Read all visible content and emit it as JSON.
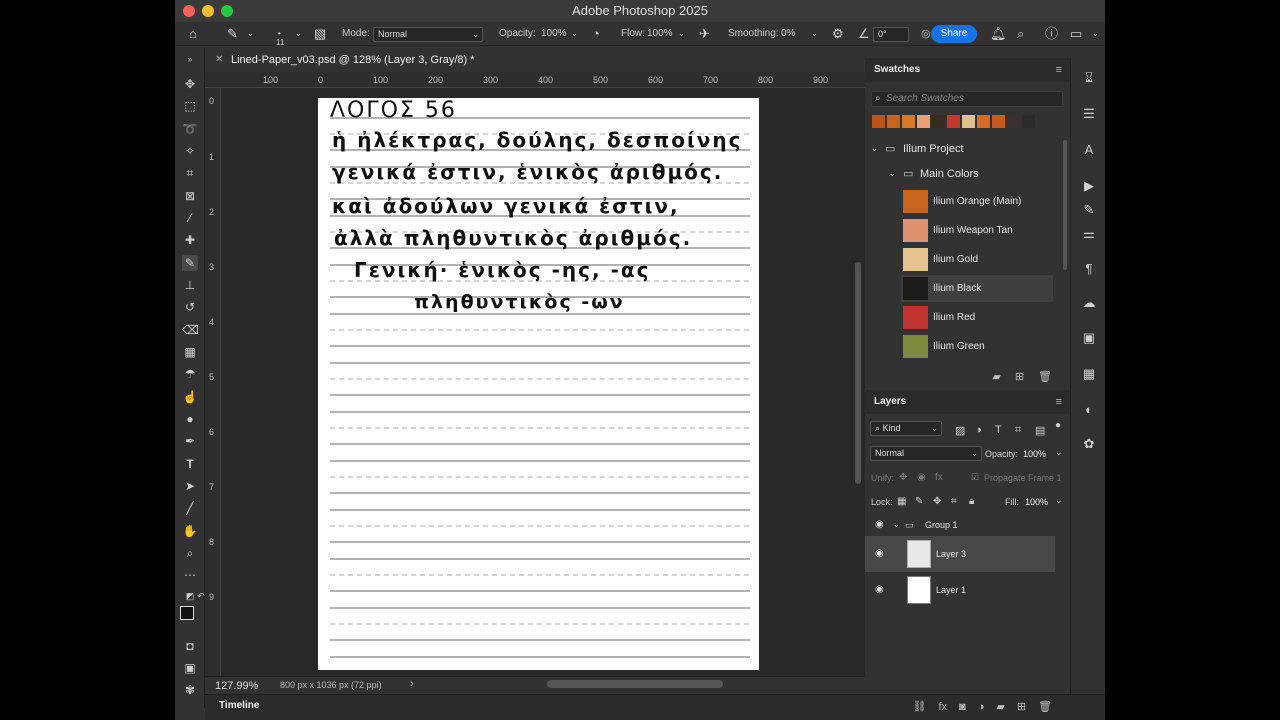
{
  "window": {
    "title": "Adobe Photoshop 2025"
  },
  "options": {
    "brush_size": "11",
    "mode_label": "Mode:",
    "mode_value": "Normal",
    "opacity_label": "Opacity:",
    "opacity_value": "100%",
    "flow_label": "Flow:",
    "flow_value": "100%",
    "smoothing_label": "Smoothing:",
    "smoothing_value": "0%",
    "angle_value": "0°",
    "share_label": "Share"
  },
  "document": {
    "tab_title": "Lined-Paper_v03.psd @ 128% (Layer 3, Gray/8) *",
    "ruler_h": [
      "100",
      "0",
      "100",
      "200",
      "300",
      "400",
      "500",
      "600",
      "700",
      "800",
      "900"
    ],
    "ruler_v": [
      "0",
      "1",
      "2",
      "3",
      "4",
      "5",
      "6",
      "7",
      "8",
      "9"
    ],
    "handwriting": [
      "ΛΟΓΟΣ 56",
      "ἡ ἠλέκτρας, δούλης, δεσποίνης",
      "γενικά ἐστιν, ἑνικὸς ἀριθμός.",
      "καὶ ἀδούλων γενικά ἐστιν,",
      "ἀλλὰ πληθυντικὸς ἀριθμός.",
      "Γενική· ἑνικὸς -ης, -ας",
      "πληθυντικὸς -ων"
    ]
  },
  "status": {
    "zoom": "127.99%",
    "doc_size": "800 px x 1036 px (72 ppi)",
    "arrow": "›"
  },
  "timeline": {
    "label": "Timeline"
  },
  "swatches": {
    "title": "Swatches",
    "search_placeholder": "Search Swatches",
    "strip_colors": [
      "#b8541c",
      "#c8641e",
      "#d87a2c",
      "#e8a070",
      "#3a2a22",
      "#c03a28",
      "#e0c08c",
      "#d86a24",
      "#c85a1c",
      "#3a3030",
      "#2c2c2c"
    ],
    "folder": "Ilium Project",
    "subfolder": "Main Colors",
    "colors": [
      {
        "name": "Ilium Orange (Main)",
        "hex": "#c8641e"
      },
      {
        "name": "Ilium Weapon Tan",
        "hex": "#e0926c"
      },
      {
        "name": "Ilium Gold",
        "hex": "#e4c48c"
      },
      {
        "name": "Ilium Black",
        "hex": "#1e1a18"
      },
      {
        "name": "Ilium Red",
        "hex": "#c03430"
      },
      {
        "name": "Ilium Green",
        "hex": "#7a8c3c"
      }
    ]
  },
  "layers": {
    "title": "Layers",
    "filter_kind": "Kind",
    "blend_mode": "Normal",
    "opacity_label": "Opacity:",
    "opacity_value": "100%",
    "unify_label": "Unify:",
    "propagate_label": "Propagate Frame 1",
    "lock_label": "Lock:",
    "fill_label": "Fill:",
    "fill_value": "100%",
    "items": [
      {
        "name": "Group 1"
      },
      {
        "name": "Layer 3"
      },
      {
        "name": "Layer 1"
      }
    ]
  }
}
